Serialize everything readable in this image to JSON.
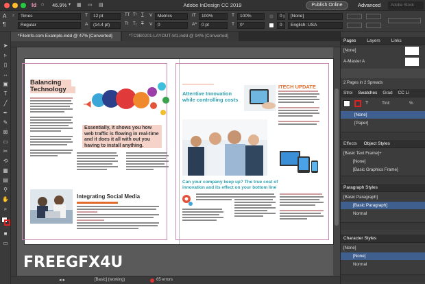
{
  "window": {
    "title": "Adobe InDesign CC 2019",
    "zoom": "46.9%",
    "publish": "Publish Online",
    "workspace": "Advanced",
    "stock_placeholder": "Adobe Stock"
  },
  "control": {
    "font": "Times",
    "style": "Regular",
    "size": "12 pt",
    "leading": "(14.4 pt)",
    "kerning": "Metrics",
    "tracking": "0",
    "scale_v": "100%",
    "scale_h": "100%",
    "baseline": "0 pt",
    "skew": "0°",
    "char_style": "[None]",
    "language": "English: USA",
    "opt1": "0 pt",
    "opt2": "0"
  },
  "tabs": [
    "*FileInfo.com Example.indd @ 47% [Converted]",
    "*TC9B0201-LAYOUT-M1.indd @ 94% [Converted]"
  ],
  "status": {
    "style": "[Basic] (working)",
    "errors": "65 errors"
  },
  "watermark": "FREEGFX4U",
  "page": {
    "h1_line1": "Balancing",
    "h1_line2": "Technology",
    "quote": "Essentially, it shows you how web traffic is flowing in real-time and it does it all with out you having to install anything.",
    "social": "Integrating Social Media",
    "r_head_1": "Attentive Innovation",
    "r_head_2": "while controlling costs",
    "itech": "ITECH UPDATE",
    "keep_up": "Can your company keep up? The true cost of innovation and its effect on your bottom line"
  },
  "panels": {
    "pages": {
      "tabs": [
        "Pages",
        "Layers",
        "Links"
      ],
      "none": "[None]",
      "master": "A-Master A",
      "summary": "2 Pages in 2 Spreads"
    },
    "swatches": {
      "tabs": [
        "Stroi",
        "Swatches",
        "Grad",
        "CC Li"
      ],
      "tint": "Tint:",
      "tint_pct": "%",
      "items": [
        "[None]",
        "[Paper]"
      ]
    },
    "object_styles": {
      "tabs": [
        "Effects",
        "Object Styles"
      ],
      "current": "[Basic Text Frame]+",
      "items": [
        "[None]",
        "[Basic Graphics Frame]"
      ]
    },
    "paragraph_styles": {
      "title": "Paragraph Styles",
      "current": "[Basic Paragraph]",
      "items": [
        "[Basic Paragraph]",
        "Normal"
      ]
    },
    "character_styles": {
      "title": "Character Styles",
      "current": "[None]",
      "items": [
        "[None]",
        "Normal"
      ]
    }
  },
  "colors": {
    "accent_selection": "#3f5f8f",
    "orange": "#e26b2c",
    "teal": "#2a9fae",
    "highlight": "#f5d3c9",
    "error": "#d33333"
  }
}
